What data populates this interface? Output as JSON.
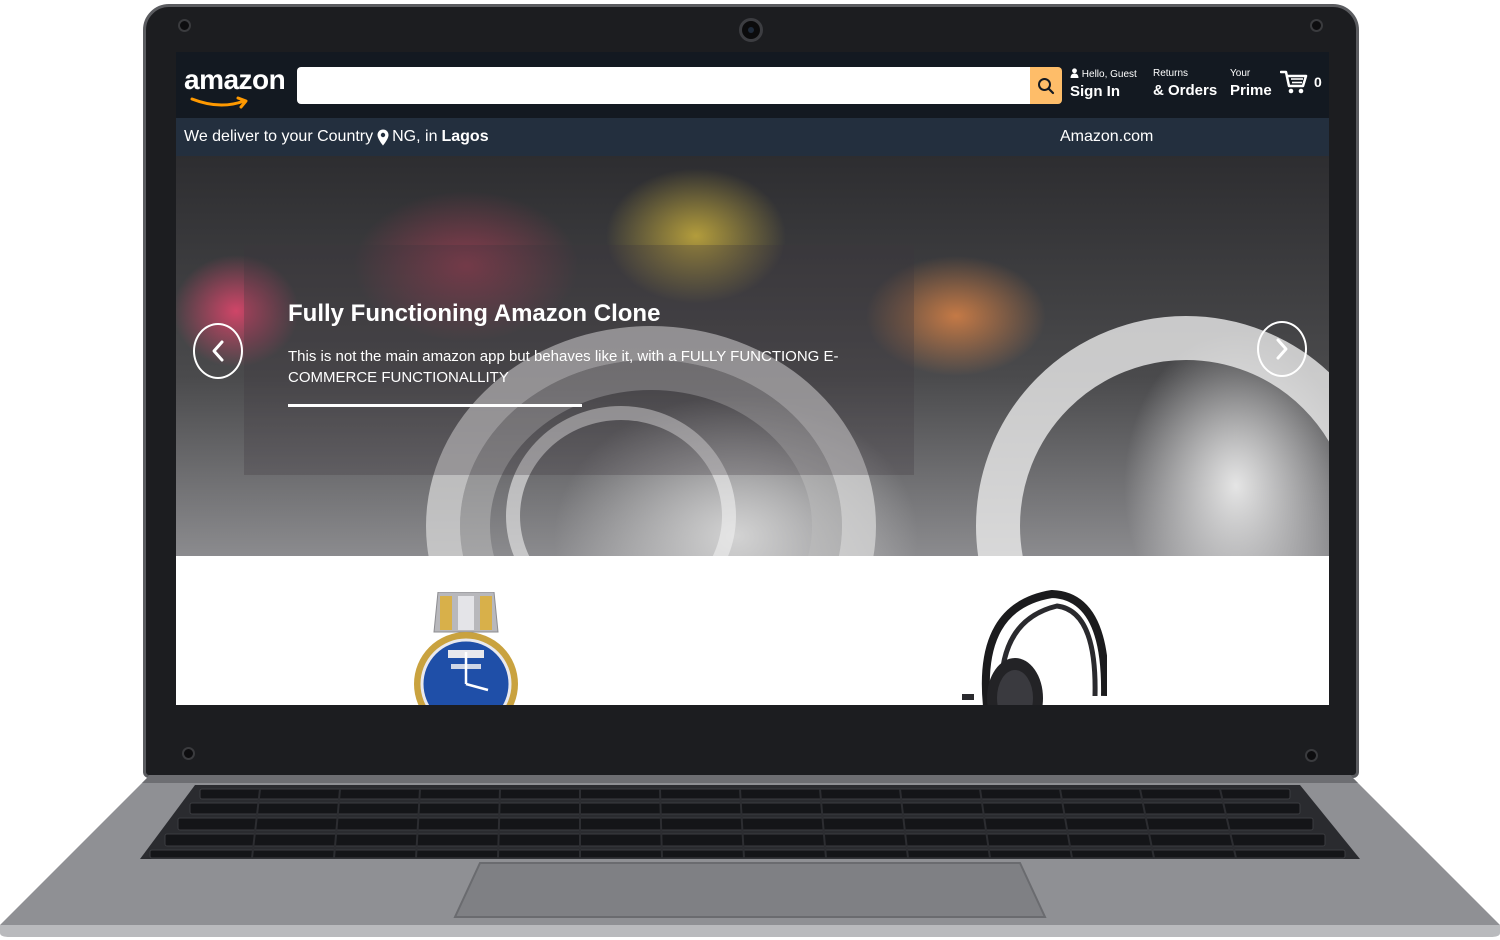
{
  "header": {
    "logo_text": "amazon",
    "search": {
      "value": "",
      "placeholder": ""
    },
    "greeting_small": "Hello, Guest",
    "greeting_big": "Sign In",
    "returns_small": "Returns",
    "returns_big": "& Orders",
    "prime_small": "Your",
    "prime_big": "Prime",
    "cart_count": "0"
  },
  "subbar": {
    "deliver_text": "We deliver to your Country",
    "country": "NG, in",
    "city": "Lagos",
    "right_link": "Amazon.com"
  },
  "hero": {
    "title": "Fully Functioning Amazon Clone",
    "description": "This is not the main amazon app but behaves like it, with a FULLY FUNCTIONG E-COMMERCE FUNCTIONALLITY"
  },
  "products": [
    {
      "name": "wristwatch"
    },
    {
      "name": "headphones"
    }
  ],
  "colors": {
    "topbar": "#131921",
    "subbar": "#232f3e",
    "search_button": "#febd69"
  }
}
